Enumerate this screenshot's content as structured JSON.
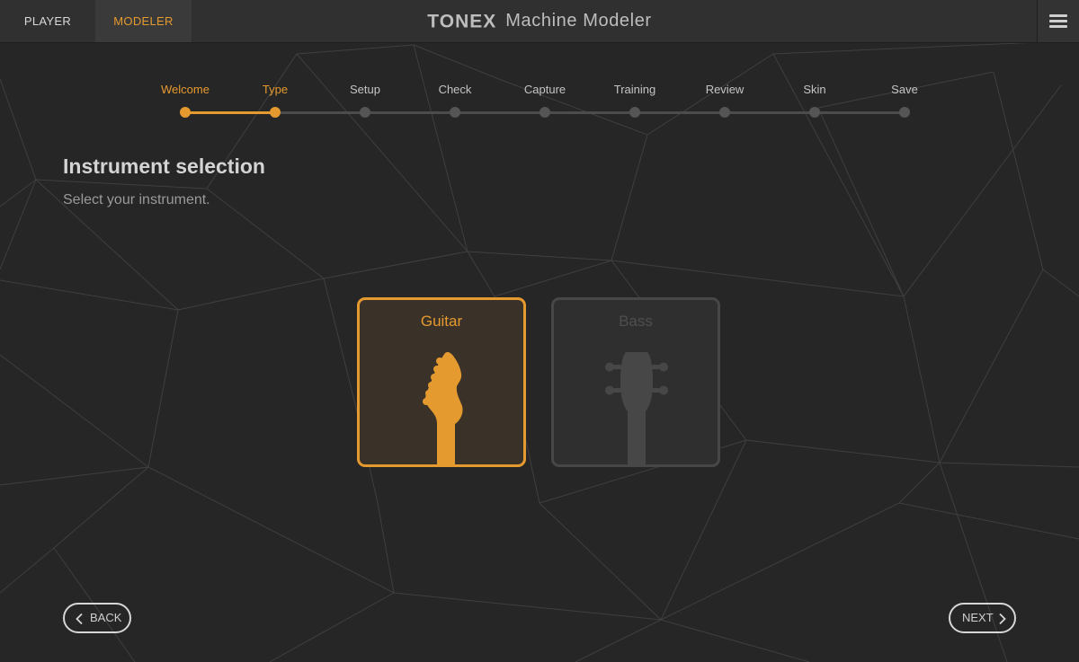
{
  "topbar": {
    "tabs": [
      {
        "label": "PLAYER",
        "active": false
      },
      {
        "label": "MODELER",
        "active": true
      }
    ],
    "brand_logo": "TONEX",
    "brand_title": "Machine Modeler"
  },
  "stepper": {
    "steps": [
      {
        "label": "Welcome",
        "state": "done"
      },
      {
        "label": "Type",
        "state": "current"
      },
      {
        "label": "Setup",
        "state": "pending"
      },
      {
        "label": "Check",
        "state": "pending"
      },
      {
        "label": "Capture",
        "state": "pending"
      },
      {
        "label": "Training",
        "state": "pending"
      },
      {
        "label": "Review",
        "state": "pending"
      },
      {
        "label": "Skin",
        "state": "pending"
      },
      {
        "label": "Save",
        "state": "pending"
      }
    ]
  },
  "page": {
    "title": "Instrument selection",
    "subtitle": "Select your instrument."
  },
  "instruments": [
    {
      "label": "Guitar",
      "selected": true
    },
    {
      "label": "Bass",
      "selected": false
    }
  ],
  "nav": {
    "back_label": "BACK",
    "next_label": "NEXT"
  },
  "colors": {
    "accent": "#e59a2f",
    "background": "#262626",
    "topbar": "#303030",
    "inactive_step": "#555555"
  },
  "icons": [
    "menu-icon",
    "guitar-headstock-icon",
    "bass-headstock-icon",
    "chevron-left-icon",
    "chevron-right-icon"
  ]
}
